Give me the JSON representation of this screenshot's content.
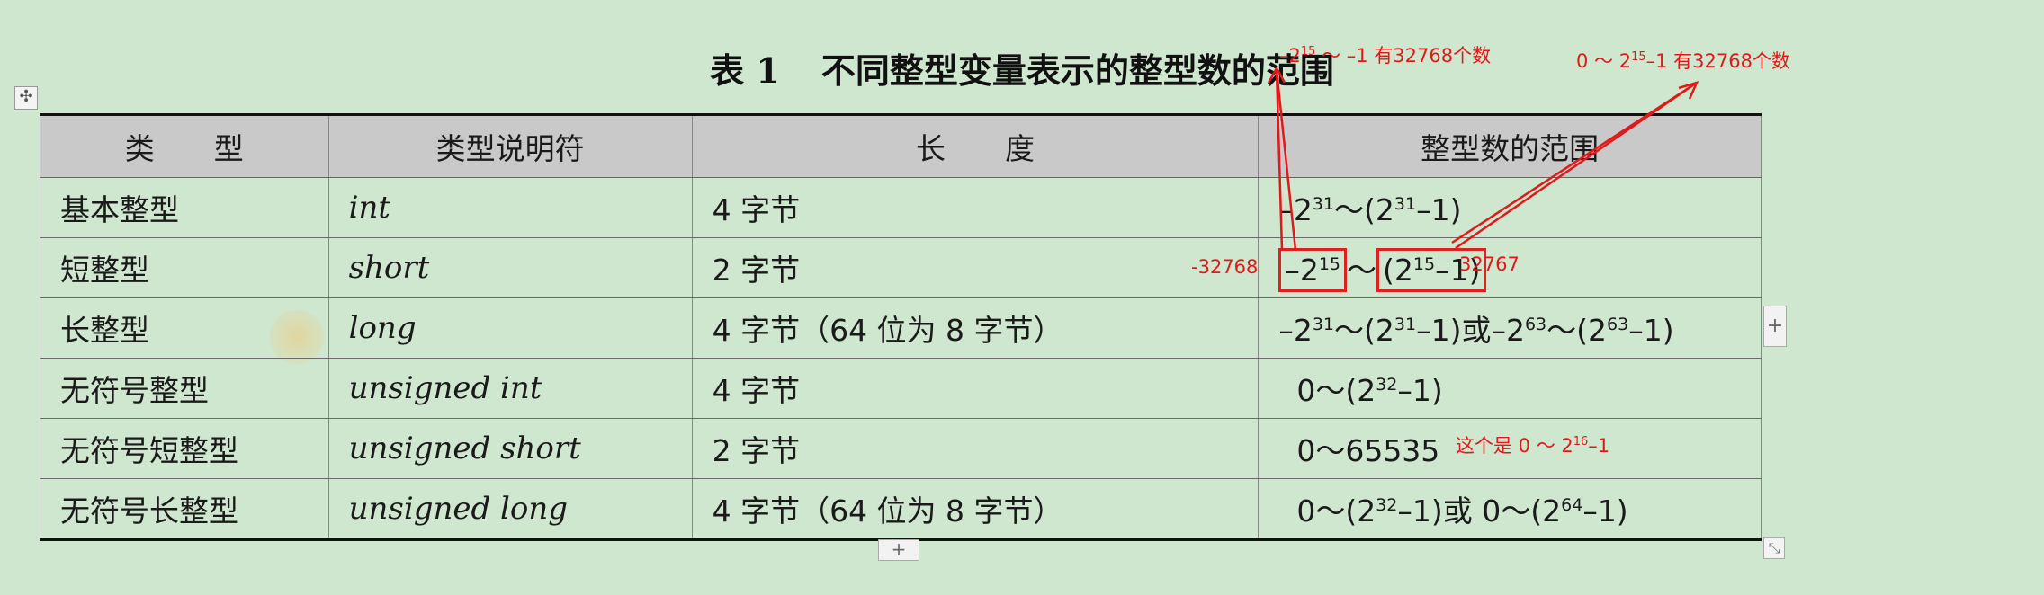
{
  "title": {
    "label": "表 1",
    "text": "不同整型变量表示的整型数的范围"
  },
  "headers": [
    "类　　型",
    "类型说明符",
    "长　　度",
    "整型数的范围"
  ],
  "rows": [
    {
      "type": "基本整型",
      "spec": "int",
      "len": "4 字节"
    },
    {
      "type": "短整型",
      "spec": "short",
      "len": "2 字节"
    },
    {
      "type": "长整型",
      "spec": "long",
      "len": "4 字节（64 位为 8 字节）"
    },
    {
      "type": "无符号整型",
      "spec": "unsigned int",
      "len": "4 字节"
    },
    {
      "type": "无符号短整型",
      "spec": "unsigned short",
      "len": "2 字节"
    },
    {
      "type": "无符号长整型",
      "spec": "unsigned long",
      "len": "4 字节（64 位为 8 字节）"
    }
  ],
  "ranges": {
    "r0": {
      "a": "–2",
      "a_exp": "31",
      "b": "～(2",
      "b_exp": "31",
      "c": "–1)"
    },
    "r1": {
      "a": "–2",
      "a_exp": "15",
      "tilde": "～",
      "b": "(2",
      "b_exp": "15",
      "c": "–1)"
    },
    "r2": {
      "a": "–2",
      "a_exp": "31",
      "b": "～(2",
      "b_exp": "31",
      "c": "–1)或–2",
      "c_exp": "63",
      "d": "～(2",
      "d_exp": "63",
      "e": "–1)"
    },
    "r3": {
      "a": "0～(2",
      "a_exp": "32",
      "b": "–1)"
    },
    "r4": {
      "a": "0～65535"
    },
    "r5": {
      "a": "0～(2",
      "a_exp": "32",
      "b": "–1)或 0～(2",
      "b_exp": "64",
      "c": "–1)"
    }
  },
  "annotations": {
    "neg_range": {
      "a": "–2",
      "a_exp": "15",
      "b": " ～ –1 有32768个数"
    },
    "pos_range": {
      "a": "0 ～ 2",
      "a_exp": "15",
      "b": "–1 有32768个数"
    },
    "min_label": "-32768",
    "max_label": "32767",
    "ushort_note": {
      "a": "这个是 0 ～ 2",
      "a_exp": "16",
      "b": "–1"
    }
  },
  "controls": {
    "plus": "+",
    "move": "✣",
    "resize": "⤡"
  },
  "colors": {
    "background": "#cfe6cf",
    "header": "#c9c9c9",
    "annotation": "#e01a1a"
  }
}
